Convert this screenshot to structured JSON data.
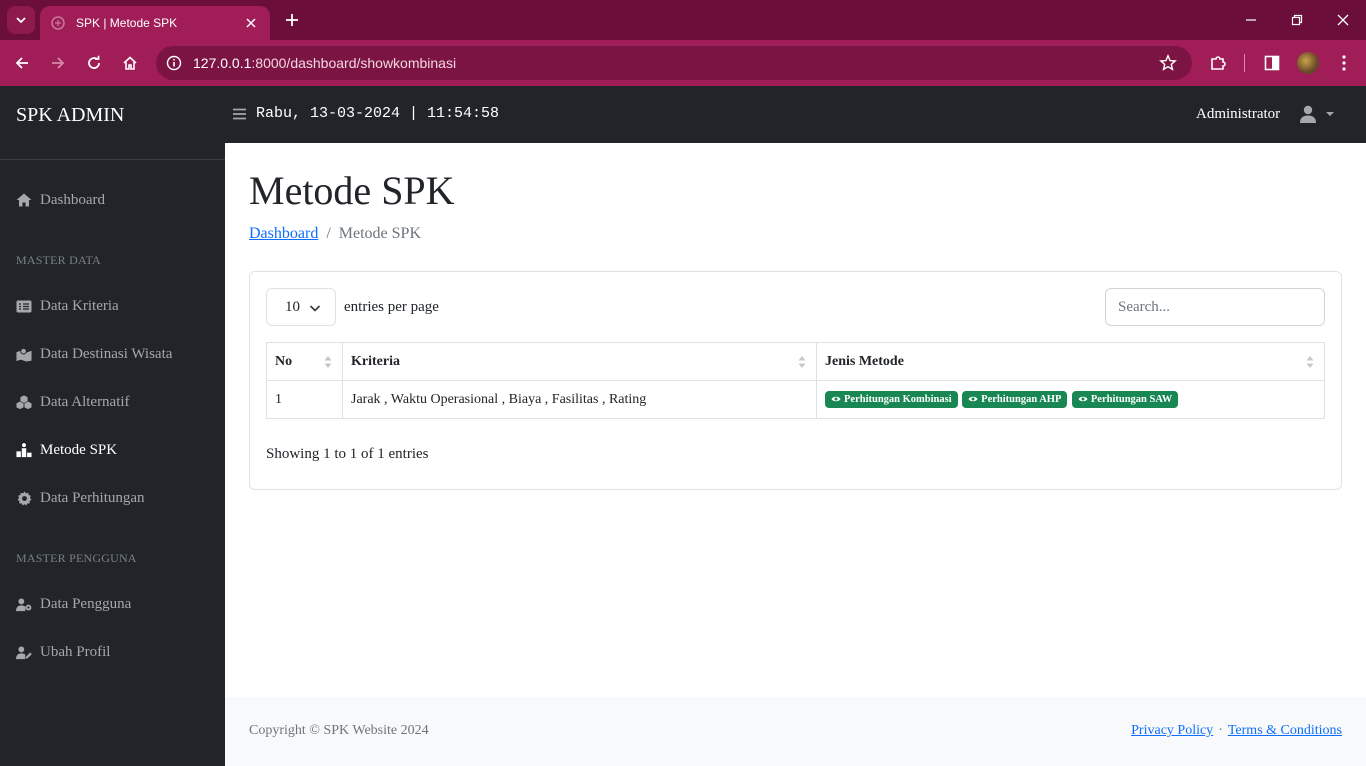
{
  "browser": {
    "tab_title": "SPK | Metode SPK",
    "url_host": "127.0.0.1",
    "url_path": ":8000/dashboard/showkombinasi"
  },
  "navbar": {
    "brand": "SPK ADMIN",
    "clock": "Rabu, 13-03-2024 | 11:54:58",
    "user_name": "Administrator"
  },
  "sidebar": {
    "dashboard": "Dashboard",
    "heading_master_data": "MASTER DATA",
    "data_kriteria": "Data Kriteria",
    "data_destinasi": "Data Destinasi Wisata",
    "data_alternatif": "Data Alternatif",
    "metode_spk": "Metode SPK",
    "data_perhitungan": "Data Perhitungan",
    "heading_master_pengguna": "MASTER PENGGUNA",
    "data_pengguna": "Data Pengguna",
    "ubah_profil": "Ubah Profil"
  },
  "main": {
    "title": "Metode SPK",
    "breadcrumb_link": "Dashboard",
    "breadcrumb_separator": "/",
    "breadcrumb_current": "Metode SPK"
  },
  "datatable": {
    "per_page_value": "10",
    "per_page_label": "entries per page",
    "search_placeholder": "Search...",
    "columns": [
      "No",
      "Kriteria",
      "Jenis Metode"
    ],
    "rows": [
      {
        "no": "1",
        "kriteria": "Jarak , Waktu Operasional , Biaya , Fasilitas , Rating",
        "badges": [
          "Perhitungan Kombinasi",
          "Perhitungan AHP",
          "Perhitungan SAW"
        ]
      }
    ],
    "info": "Showing 1 to 1 of 1 entries"
  },
  "footer": {
    "copyright": "Copyright © SPK Website 2024",
    "privacy": "Privacy Policy",
    "dot": "·",
    "terms": "Terms & Conditions"
  },
  "colors": {
    "tabbar": "#6b0f3a",
    "toolbar": "#a01d57",
    "sidebar": "#212529",
    "badge": "#198754",
    "link": "#0d6efd"
  }
}
